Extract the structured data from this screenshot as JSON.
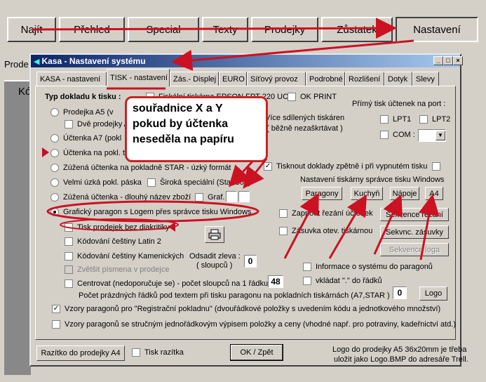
{
  "toolbar": {
    "buttons": [
      "Najít",
      "Přehled",
      "Special",
      "Texty",
      "Prodejky",
      "Zůstatek",
      "Nastavení"
    ]
  },
  "background": {
    "title": "Prode",
    "panel_label": "Kó"
  },
  "dialog": {
    "title": "Kasa - Nastavení systému",
    "tabs": [
      "KASA - nastavení",
      "TISK - nastavení",
      "Zás.- Displej",
      "EURO",
      "Síťový provoz",
      "Podrobné",
      "Rozlišení",
      "Dotyk",
      "Slevy"
    ],
    "selected_tab": "TISK - nastavení"
  },
  "panel": {
    "typ_dokladu": "Typ dokladu k tisku :",
    "top_options": [
      "Fiskální tiskárna EPSON FPT 220 UC",
      "OK PRINT"
    ],
    "radios": [
      "Prodejka A5 (v",
      "Účtenka A7  (pokl",
      "Účtenka na pokl. ti",
      "Zúžená účtenka na pokladně STAR - úzký formát",
      "Velmi úzká pokl. páska",
      "Zúžená účtenka - dlouhý název zboží",
      "Grafický paragon s Logem přes správce tisku Windows"
    ],
    "dve_prodejky": "Dvě prodejky A",
    "siroka_specialni": "Široká speciální (Star 300)",
    "graf_label": "Graf.",
    "tisk_prodejek": "Tisk prodejek bez diakritiky",
    "kodovani_latin2": "Kódování češtiny Latin 2",
    "kodovani_kamenicti": "Kódování češtiny Kamenických",
    "zvetsit": "Zvětšit písmena v prodejce",
    "centrovat": "Centrovat (nedoporučuje se) - počet sloupců na 1 řádku",
    "centrovat_value": "48",
    "odsadit": "Odsadit zleva :",
    "odsadit_sub": "( sloupců )",
    "odsadit_value": "0",
    "pocet_prazdnych": "Počet prázdných řádků pod textem při tisku paragonu na pokladních tiskárnách (A7,STAR ) :",
    "pocet_value": "0",
    "logo_btn": "Logo",
    "vzory_registracni": "Vzory paragonů pro \"Registrační pokladnu\" (dvouřádkové položky s uvedením kódu a jednotkového množství)",
    "vzory_strucny": "Vzory paragonů se stručným jednořádkovým výpisem položky a ceny (vhodné např. pro potraviny, kadeřnictví atd.)",
    "vice_sdilenych": "Více sdílených tiskáren",
    "bezne": "( běžně nezaškrtávat )",
    "primy_tisk": "Přímý tisk účtenek na port :",
    "lpt1": "LPT1",
    "lpt2": "LPT2",
    "com": "COM :",
    "tisknout_doklady": "Tisknout doklady zpětně i při vypnutém tisku",
    "nastaveni_tiskarny": "Nastavení tiskárny správce tisku Windows",
    "print_buttons": [
      "Paragony",
      "Kuchyň",
      "Nápoje",
      "A4"
    ],
    "zapnout_rezani": "Zapnout řezání účtenek",
    "zasuvka": "Zásuvka otev. tiskárnou",
    "sekvence_rezani": "Sekvence řezání",
    "sekvence_zasuvky": "Sekvnc. zásuvky",
    "sekvence_loga": "Sekvence loga",
    "informace": "Informace o systému do paragonů",
    "vkladat": "vkládat \".\" do řádků"
  },
  "footer": {
    "razitko_btn": "Razítko do prodejky A4",
    "tisk_razitka": "Tisk razítka",
    "ok_btn": "OK / Zpět",
    "logo_note_1": "Logo do prodejky A5 36x20mm je třeba",
    "logo_note_2": "uložit jako Logo.BMP do adresáře Trell."
  },
  "annotation": {
    "lines": [
      "souřadnice X a Y",
      "pokud by účtenka",
      "neseděla na papíru"
    ]
  },
  "colors": {
    "accent_red": "#cc2222",
    "title_blue": "#0a246a"
  }
}
